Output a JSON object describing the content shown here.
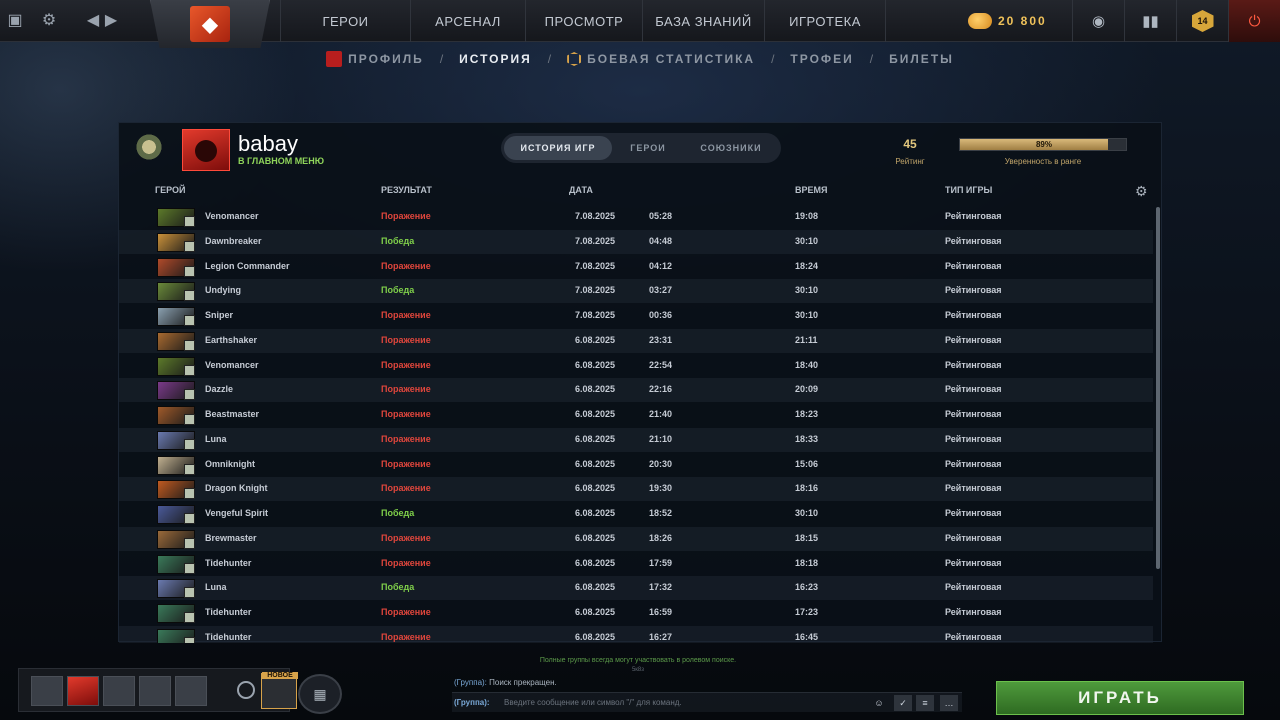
{
  "topbar": {
    "nav": [
      "ГЕРОИ",
      "АРСЕНАЛ",
      "ПРОСМОТР",
      "БАЗА ЗНАНИЙ",
      "ИГРОТЕКА"
    ],
    "currency": "20 800",
    "badge_count": "14"
  },
  "subnav": {
    "items": [
      "ПРОФИЛЬ",
      "ИСТОРИЯ",
      "БОЕВАЯ СТАТИСТИКА",
      "ТРОФЕИ",
      "БИЛЕТЫ"
    ],
    "separator": "/",
    "active": "ИСТОРИЯ"
  },
  "profile": {
    "name": "babay",
    "status": "В ГЛАВНОМ МЕНЮ",
    "rating": "45",
    "rating_label": "Рейтинг",
    "confidence": 0.89,
    "confidence_text": "89%",
    "confidence_label": "Уверенность в ранге"
  },
  "tabs": [
    "ИСТОРИЯ ИГР",
    "ГЕРОИ",
    "СОЮЗНИКИ"
  ],
  "columns": {
    "hero": "ГЕРОЙ",
    "result": "РЕЗУЛЬТАТ",
    "date": "ДАТА",
    "duration": "ВРЕМЯ",
    "type": "ТИП ИГРЫ"
  },
  "matches": [
    {
      "hero": "Venomancer",
      "result": "Поражение",
      "win": false,
      "date": "7.08.2025",
      "time": "05:28",
      "duration": "19:08",
      "type": "Рейтинговая",
      "color": "#5c7a2a"
    },
    {
      "hero": "Dawnbreaker",
      "result": "Победа",
      "win": true,
      "date": "7.08.2025",
      "time": "04:48",
      "duration": "30:10",
      "type": "Рейтинговая",
      "color": "#c9913a"
    },
    {
      "hero": "Legion Commander",
      "result": "Поражение",
      "win": false,
      "date": "7.08.2025",
      "time": "04:12",
      "duration": "18:24",
      "type": "Рейтинговая",
      "color": "#b04a2a"
    },
    {
      "hero": "Undying",
      "result": "Победа",
      "win": true,
      "date": "7.08.2025",
      "time": "03:27",
      "duration": "30:10",
      "type": "Рейтинговая",
      "color": "#6a8a3a"
    },
    {
      "hero": "Sniper",
      "result": "Поражение",
      "win": false,
      "date": "7.08.2025",
      "time": "00:36",
      "duration": "30:10",
      "type": "Рейтинговая",
      "color": "#8aa0b0"
    },
    {
      "hero": "Earthshaker",
      "result": "Поражение",
      "win": false,
      "date": "6.08.2025",
      "time": "23:31",
      "duration": "21:11",
      "type": "Рейтинговая",
      "color": "#a86a30"
    },
    {
      "hero": "Venomancer",
      "result": "Поражение",
      "win": false,
      "date": "6.08.2025",
      "time": "22:54",
      "duration": "18:40",
      "type": "Рейтинговая",
      "color": "#5c7a2a"
    },
    {
      "hero": "Dazzle",
      "result": "Поражение",
      "win": false,
      "date": "6.08.2025",
      "time": "22:16",
      "duration": "20:09",
      "type": "Рейтинговая",
      "color": "#7a3a8a"
    },
    {
      "hero": "Beastmaster",
      "result": "Поражение",
      "win": false,
      "date": "6.08.2025",
      "time": "21:40",
      "duration": "18:23",
      "type": "Рейтинговая",
      "color": "#a05a2a"
    },
    {
      "hero": "Luna",
      "result": "Поражение",
      "win": false,
      "date": "6.08.2025",
      "time": "21:10",
      "duration": "18:33",
      "type": "Рейтинговая",
      "color": "#6a7ab0"
    },
    {
      "hero": "Omniknight",
      "result": "Поражение",
      "win": false,
      "date": "6.08.2025",
      "time": "20:30",
      "duration": "15:06",
      "type": "Рейтинговая",
      "color": "#c0b090"
    },
    {
      "hero": "Dragon Knight",
      "result": "Поражение",
      "win": false,
      "date": "6.08.2025",
      "time": "19:30",
      "duration": "18:16",
      "type": "Рейтинговая",
      "color": "#c05a20"
    },
    {
      "hero": "Vengeful Spirit",
      "result": "Победа",
      "win": true,
      "date": "6.08.2025",
      "time": "18:52",
      "duration": "30:10",
      "type": "Рейтинговая",
      "color": "#4a5a9a"
    },
    {
      "hero": "Brewmaster",
      "result": "Поражение",
      "win": false,
      "date": "6.08.2025",
      "time": "18:26",
      "duration": "18:15",
      "type": "Рейтинговая",
      "color": "#9a6a3a"
    },
    {
      "hero": "Tidehunter",
      "result": "Поражение",
      "win": false,
      "date": "6.08.2025",
      "time": "17:59",
      "duration": "18:18",
      "type": "Рейтинговая",
      "color": "#3a7a5a"
    },
    {
      "hero": "Luna",
      "result": "Победа",
      "win": true,
      "date": "6.08.2025",
      "time": "17:32",
      "duration": "16:23",
      "type": "Рейтинговая",
      "color": "#6a7ab0"
    },
    {
      "hero": "Tidehunter",
      "result": "Поражение",
      "win": false,
      "date": "6.08.2025",
      "time": "16:59",
      "duration": "17:23",
      "type": "Рейтинговая",
      "color": "#3a7a5a"
    },
    {
      "hero": "Tidehunter",
      "result": "Поражение",
      "win": false,
      "date": "6.08.2025",
      "time": "16:27",
      "duration": "16:45",
      "type": "Рейтинговая",
      "color": "#3a7a5a"
    }
  ],
  "bottom": {
    "new_label": "НОВОЕ",
    "chat_hint": "Полные группы всегда могут участвовать в ролевом поиске.",
    "chat_hint2": "5к8з",
    "chat_channel_line": "(Группа):",
    "chat_message": "Поиск прекращен.",
    "chat_input_channel": "(Группа):",
    "chat_placeholder": "Введите сообщение или символ \"/\" для команд.",
    "play": "ИГРАТЬ"
  }
}
